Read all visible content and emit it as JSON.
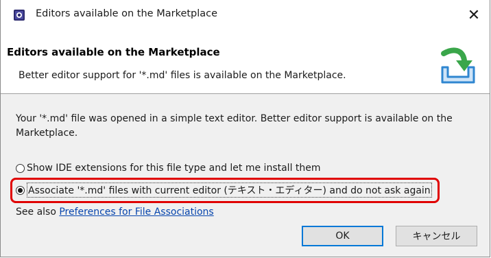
{
  "window": {
    "title": "Editors available on the Marketplace",
    "close_glyph": "✕"
  },
  "banner": {
    "title": "Editors available on the Marketplace",
    "description": "Better editor support for '*.md' files is available on the Marketplace.",
    "icon": "download-to-tray-icon"
  },
  "body": {
    "message": "Your '*.md' file was opened in a simple text editor. Better editor support is available on the Marketplace.",
    "options": [
      {
        "label": "Show IDE extensions for this file type and let me install them",
        "selected": false
      },
      {
        "label": "Associate '*.md' files with current editor (テキスト・エディター) and do not ask again",
        "selected": true
      }
    ],
    "see_also_prefix": "See also ",
    "see_also_link": "Preferences for File Associations"
  },
  "buttons": {
    "ok": "OK",
    "cancel": "キャンセル"
  },
  "colors": {
    "highlight": "#e00000",
    "link": "#0645ad",
    "default_button_border": "#0078d7",
    "icon_arrow": "#3aa64a",
    "icon_tray": "#2f86d0"
  }
}
